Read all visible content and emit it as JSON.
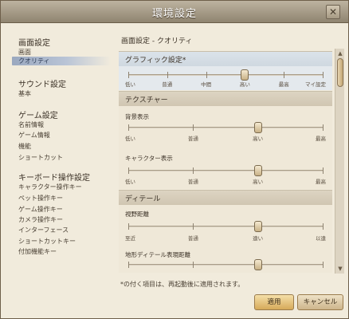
{
  "window": {
    "title": "環境設定",
    "close_label": "✕"
  },
  "sidebar": {
    "categories": [
      {
        "label": "画面設定",
        "items": [
          "画面",
          "クオリティ"
        ]
      },
      {
        "label": "サウンド設定",
        "items": [
          "基本"
        ]
      },
      {
        "label": "ゲーム設定",
        "items": [
          "名前情報",
          "ゲーム情報",
          "機能",
          "ショートカット"
        ]
      },
      {
        "label": "キーボード操作設定",
        "items": [
          "キャラクター操作キー",
          "ペット操作キー",
          "ゲーム操作キー",
          "カメラ操作キー",
          "インターフェース",
          "ショートカットキー",
          "付加機能キー"
        ]
      }
    ],
    "selected_item": "クオリティ"
  },
  "panel": {
    "title": "画面設定 - クオリティ",
    "sections": [
      {
        "header": "グラフィック設定*",
        "sliders": [
          {
            "label": "",
            "ticks": [
              "低い",
              "普通",
              "中間",
              "高い",
              "最高",
              "マイ設定"
            ],
            "value_index": 3
          }
        ]
      },
      {
        "header": "テクスチャー",
        "sliders": [
          {
            "label": "背景表示",
            "ticks": [
              "低い",
              "普通",
              "高い",
              "最高"
            ],
            "value_index": 2
          },
          {
            "label": "キャラクター表示",
            "ticks": [
              "低い",
              "普通",
              "高い",
              "最高"
            ],
            "value_index": 2
          }
        ]
      },
      {
        "header": "ディテール",
        "sliders": [
          {
            "label": "視野距離",
            "ticks": [
              "至近",
              "普通",
              "遠い",
              "以遠"
            ],
            "value_index": 2
          },
          {
            "label": "地形ディテール表現距離",
            "ticks": [],
            "value_index": 2
          }
        ]
      }
    ]
  },
  "footer": {
    "note": "*の付く項目は、再起動後に適用されます。",
    "apply_label": "適用",
    "cancel_label": "キャンセル"
  }
}
